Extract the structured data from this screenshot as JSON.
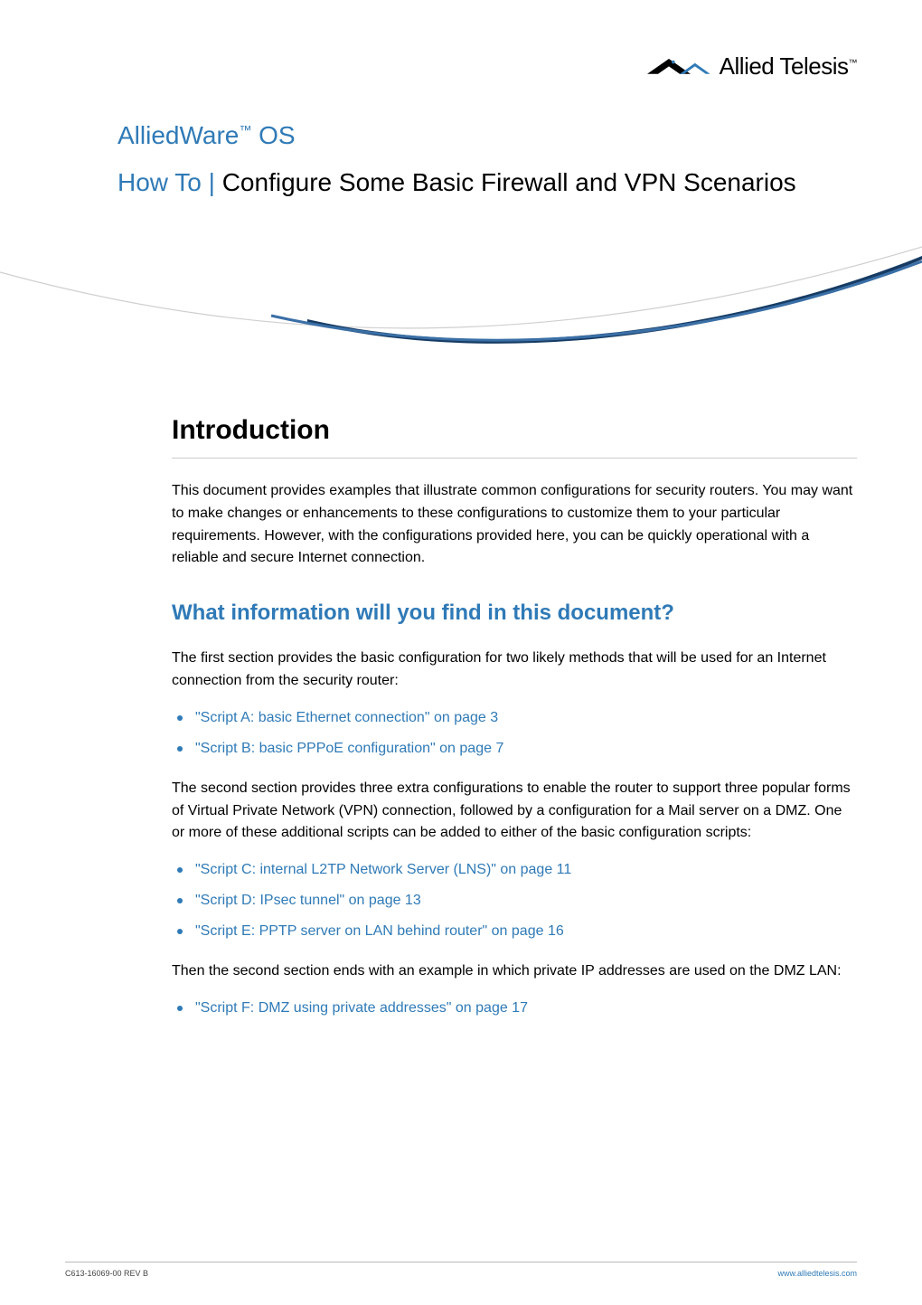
{
  "brand": {
    "logo_text": "Allied Telesis",
    "tm": "™",
    "tm2": "™"
  },
  "header": {
    "product": "AlliedWare",
    "os": " OS",
    "howto_prefix": "How To",
    "separator": " | ",
    "title": "Configure Some Basic Firewall and VPN Scenarios"
  },
  "intro": {
    "heading": "Introduction",
    "paragraph": "This document provides examples that illustrate common configurations for security routers. You may want to make changes or enhancements to these configurations to customize them to your particular requirements. However, with the configurations provided here, you can be quickly operational with a reliable and secure Internet connection."
  },
  "section_what": {
    "heading": "What information will you find in this document?",
    "lead_paragraph": "The first section provides the basic configuration for two likely methods that will be used for an Internet connection from the security router:",
    "list1": [
      "\"Script A: basic Ethernet connection\" on page 3",
      "\"Script B: basic PPPoE configuration\" on page 7"
    ],
    "mid_paragraph": "The second section provides three extra configurations to enable the router to support three popular forms of Virtual Private Network (VPN) connection, followed by a configuration for a Mail server on a DMZ. One or more of these additional scripts can be added to either of the basic configuration scripts:",
    "list2": [
      "\"Script C: internal L2TP Network Server (LNS)\" on page 11",
      "\"Script D: IPsec tunnel\" on page 13",
      "\"Script E: PPTP server on LAN behind router\" on page 16"
    ],
    "tail_paragraph": "Then the second section ends with an example in which private IP addresses are used on the DMZ LAN:",
    "list3": [
      "\"Script F: DMZ using private addresses\" on page 17"
    ]
  },
  "footer": {
    "left": "C613-16069-00 REV B",
    "right": "www.alliedtelesis.com"
  }
}
